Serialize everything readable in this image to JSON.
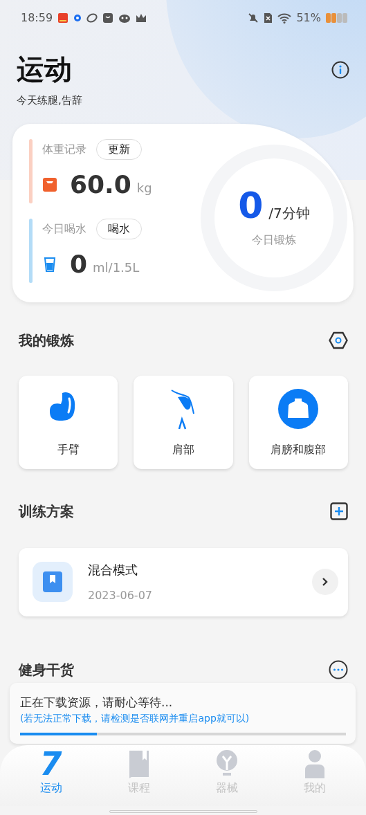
{
  "status_bar": {
    "time": "18:59",
    "battery": "51%"
  },
  "header": {
    "title": "运动",
    "subtitle": "今天练腿,告辞"
  },
  "summary": {
    "records": [
      {
        "kind": "weight",
        "label": "体重记录",
        "button": "更新",
        "value": "60.0",
        "unit": "kg",
        "color": "#fbd0c2"
      },
      {
        "kind": "water",
        "label": "今日喝水",
        "button": "喝水",
        "value": "0",
        "unit": "ml/1.5L",
        "color": "#b3dcf7"
      }
    ],
    "ring": {
      "value": "0",
      "target": "/7分钟",
      "label": "今日锻炼"
    }
  },
  "my_training": {
    "title": "我的锻炼",
    "items": [
      {
        "kind": "arm",
        "label": "手臂"
      },
      {
        "kind": "shoulder",
        "label": "肩部"
      },
      {
        "kind": "torso",
        "label": "肩膀和腹部"
      }
    ]
  },
  "plans": {
    "title": "训练方案",
    "items": [
      {
        "name": "混合模式",
        "date": "2023-06-07"
      }
    ]
  },
  "articles": {
    "title": "健身干货"
  },
  "download": {
    "message": "正在下载资源，请耐心等待...",
    "hint": "(若无法正常下载，请检测是否联网并重启app就可以)",
    "level": 0.235
  },
  "tabs": [
    {
      "kind": "sport",
      "label": "运动",
      "glyph": "7",
      "selected": true
    },
    {
      "kind": "course",
      "label": "课程",
      "selected": false
    },
    {
      "kind": "equipment",
      "label": "器械",
      "selected": false
    },
    {
      "kind": "profile",
      "label": "我的",
      "selected": false
    }
  ]
}
